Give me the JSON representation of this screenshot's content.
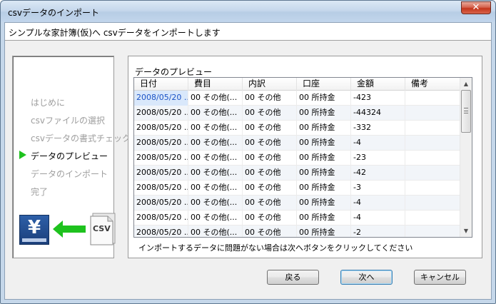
{
  "window": {
    "title": "csvデータのインポート",
    "close_glyph": "✕"
  },
  "header": {
    "text": "シンプルな家計簿(仮)へ csvデータをインポートします"
  },
  "steps": [
    {
      "label": "はじめに",
      "active": false
    },
    {
      "label": "csvファイルの選択",
      "active": false
    },
    {
      "label": "csvデータの書式チェック",
      "active": false
    },
    {
      "label": "データのプレビュー",
      "active": true
    },
    {
      "label": "データのインポート",
      "active": false
    },
    {
      "label": "完了",
      "active": false
    }
  ],
  "icons": {
    "yen": "¥",
    "csv": "CSV",
    "arrow": "green-left-arrow"
  },
  "preview": {
    "title": "データのプレビュー",
    "columns": [
      "日付",
      "費目",
      "内訳",
      "口座",
      "金額",
      "備考"
    ],
    "rows": [
      [
        "2008/05/20 ...",
        "00 その他(...",
        "00 その他",
        "00 所持金",
        "-423",
        ""
      ],
      [
        "2008/05/20 ...",
        "00 その他(...",
        "00 その他",
        "00 所持金",
        "-44324",
        ""
      ],
      [
        "2008/05/20 ...",
        "00 その他(...",
        "00 その他",
        "00 所持金",
        "-332",
        ""
      ],
      [
        "2008/05/20 ...",
        "00 その他(...",
        "00 その他",
        "00 所持金",
        "-4",
        ""
      ],
      [
        "2008/05/20 ...",
        "00 その他(...",
        "00 その他",
        "00 所持金",
        "-23",
        ""
      ],
      [
        "2008/05/20 ...",
        "00 その他(...",
        "00 その他",
        "00 所持金",
        "-42",
        ""
      ],
      [
        "2008/05/20 ...",
        "00 その他(...",
        "00 その他",
        "00 所持金",
        "-3",
        ""
      ],
      [
        "2008/05/20 ...",
        "00 その他(...",
        "00 その他",
        "00 所持金",
        "-4",
        ""
      ],
      [
        "2008/05/20 ...",
        "00 その他(...",
        "00 その他",
        "00 所持金",
        "-4",
        ""
      ],
      [
        "2008/05/20 ...",
        "00 その他(...",
        "00 その他",
        "00 所持金",
        "-2",
        ""
      ]
    ],
    "footer": "インポートするデータに問題がない場合は次へボタンをクリックしてください"
  },
  "scrollbar": {
    "up": "▲",
    "down": "▼"
  },
  "buttons": {
    "back": "戻る",
    "next": "次へ",
    "cancel": "キャンセル"
  },
  "colors": {
    "accent_green": "#1ec21e",
    "selection": "#d9e8fb"
  }
}
